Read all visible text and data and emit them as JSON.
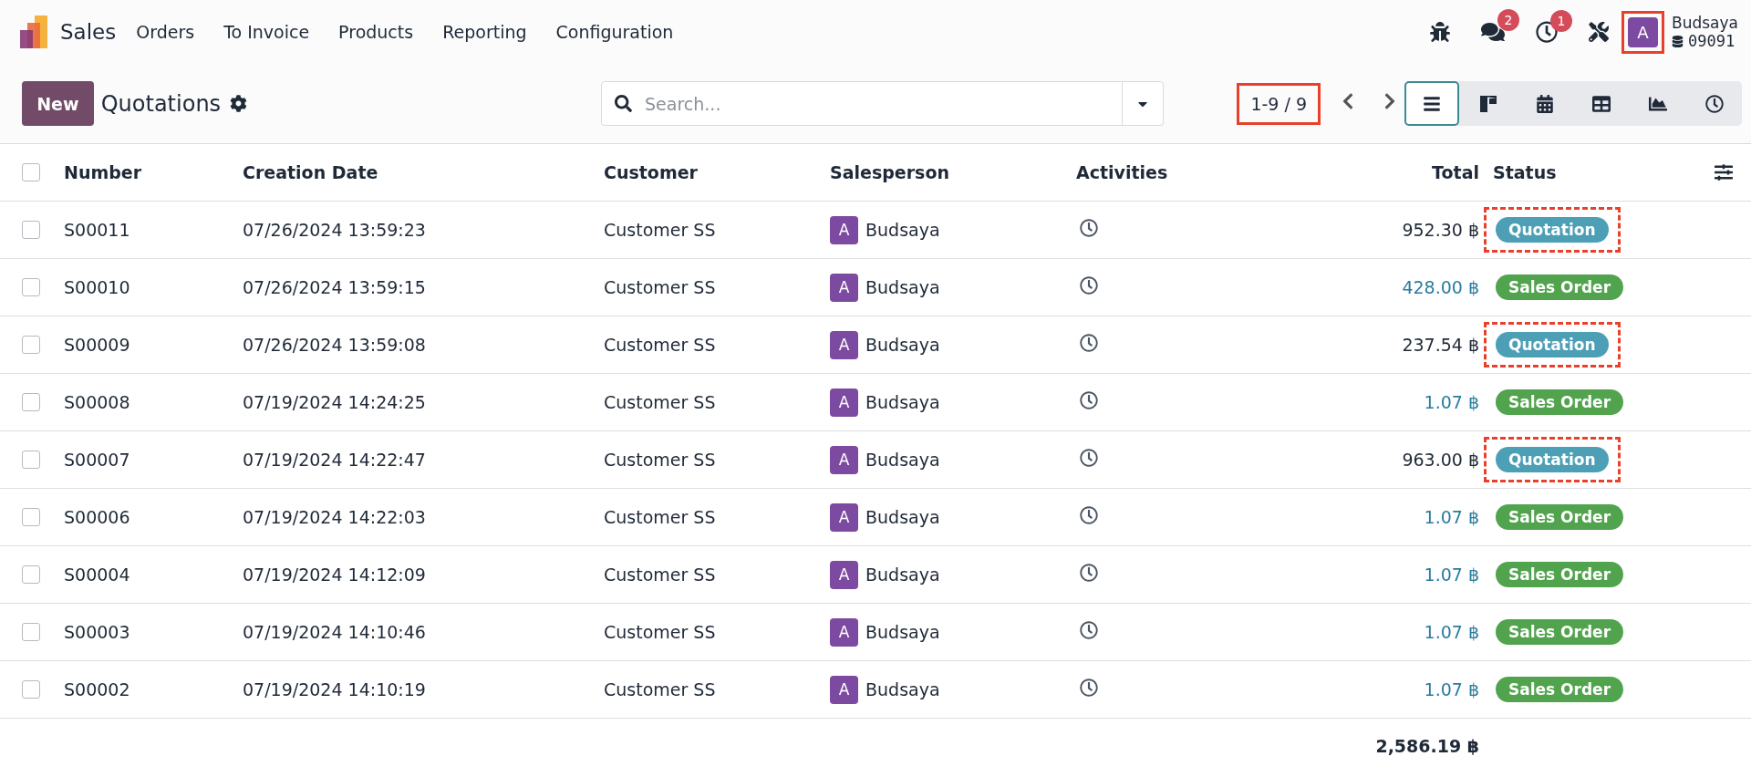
{
  "navbar": {
    "app_name": "Sales",
    "menu": [
      "Orders",
      "To Invoice",
      "Products",
      "Reporting",
      "Configuration"
    ],
    "chat_count": "2",
    "activity_count": "1",
    "user": {
      "initial": "A",
      "name": "Budsaya",
      "database": "09091",
      "highlighted": true
    }
  },
  "control_panel": {
    "new_button": "New",
    "title": "Quotations",
    "search": {
      "placeholder": "Search..."
    },
    "pager": {
      "text": "1-9 / 9",
      "highlighted": true
    },
    "views": [
      {
        "kind": "list",
        "selected": true
      },
      {
        "kind": "kanban",
        "selected": false
      },
      {
        "kind": "calendar",
        "selected": false
      },
      {
        "kind": "pivot",
        "selected": false
      },
      {
        "kind": "graph",
        "selected": false
      },
      {
        "kind": "activity",
        "selected": false
      }
    ]
  },
  "table": {
    "select_all_checked": false,
    "columns": [
      "Number",
      "Creation Date",
      "Customer",
      "Salesperson",
      "Activities",
      "Total",
      "Status"
    ],
    "rows": [
      {
        "checked": false,
        "number": "S00011",
        "date": "07/26/2024 13:59:23",
        "customer": "Customer SS",
        "salesperson": {
          "initial": "A",
          "name": "Budsaya"
        },
        "total": "952.30 ฿",
        "status": {
          "label": "Quotation",
          "kind": "quotation"
        },
        "highlighted": true
      },
      {
        "checked": false,
        "number": "S00010",
        "date": "07/26/2024 13:59:15",
        "customer": "Customer SS",
        "salesperson": {
          "initial": "A",
          "name": "Budsaya"
        },
        "total": "428.00 ฿",
        "status": {
          "label": "Sales Order",
          "kind": "sale"
        },
        "highlighted": false
      },
      {
        "checked": false,
        "number": "S00009",
        "date": "07/26/2024 13:59:08",
        "customer": "Customer SS",
        "salesperson": {
          "initial": "A",
          "name": "Budsaya"
        },
        "total": "237.54 ฿",
        "status": {
          "label": "Quotation",
          "kind": "quotation"
        },
        "highlighted": true
      },
      {
        "checked": false,
        "number": "S00008",
        "date": "07/19/2024 14:24:25",
        "customer": "Customer SS",
        "salesperson": {
          "initial": "A",
          "name": "Budsaya"
        },
        "total": "1.07 ฿",
        "status": {
          "label": "Sales Order",
          "kind": "sale"
        },
        "highlighted": false
      },
      {
        "checked": false,
        "number": "S00007",
        "date": "07/19/2024 14:22:47",
        "customer": "Customer SS",
        "salesperson": {
          "initial": "A",
          "name": "Budsaya"
        },
        "total": "963.00 ฿",
        "status": {
          "label": "Quotation",
          "kind": "quotation"
        },
        "highlighted": true
      },
      {
        "checked": false,
        "number": "S00006",
        "date": "07/19/2024 14:22:03",
        "customer": "Customer SS",
        "salesperson": {
          "initial": "A",
          "name": "Budsaya"
        },
        "total": "1.07 ฿",
        "status": {
          "label": "Sales Order",
          "kind": "sale"
        },
        "highlighted": false
      },
      {
        "checked": false,
        "number": "S00004",
        "date": "07/19/2024 14:12:09",
        "customer": "Customer SS",
        "salesperson": {
          "initial": "A",
          "name": "Budsaya"
        },
        "total": "1.07 ฿",
        "status": {
          "label": "Sales Order",
          "kind": "sale"
        },
        "highlighted": false
      },
      {
        "checked": false,
        "number": "S00003",
        "date": "07/19/2024 14:10:46",
        "customer": "Customer SS",
        "salesperson": {
          "initial": "A",
          "name": "Budsaya"
        },
        "total": "1.07 ฿",
        "status": {
          "label": "Sales Order",
          "kind": "sale"
        },
        "highlighted": false
      },
      {
        "checked": false,
        "number": "S00002",
        "date": "07/19/2024 14:10:19",
        "customer": "Customer SS",
        "salesperson": {
          "initial": "A",
          "name": "Budsaya"
        },
        "total": "1.07 ฿",
        "status": {
          "label": "Sales Order",
          "kind": "sale"
        },
        "highlighted": false
      }
    ],
    "footer_total": "2,586.19 ฿"
  }
}
